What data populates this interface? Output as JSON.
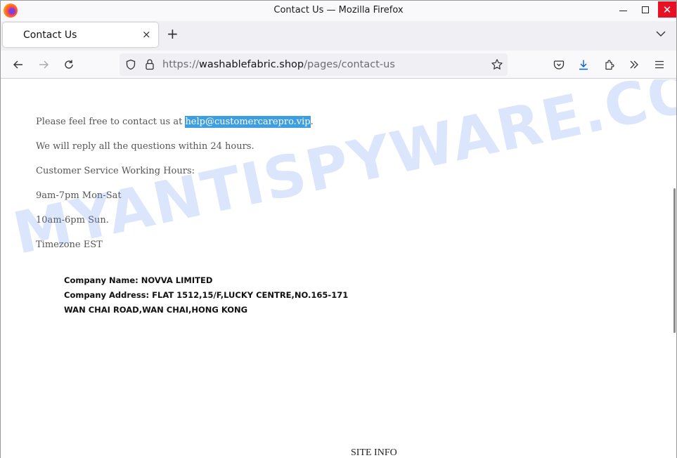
{
  "window": {
    "title": "Contact Us — Mozilla Firefox",
    "minimize_label": "—",
    "close_label": "✕"
  },
  "tabs": [
    {
      "label": "Contact Us",
      "active": true,
      "close_label": "×"
    }
  ],
  "tabstrip": {
    "new_tab_label": "+"
  },
  "navbar": {
    "url_scheme": "https://",
    "url_host": "washablefabric.shop",
    "url_path": "/pages/contact-us",
    "icons": [
      "back-icon",
      "forward-icon",
      "reload-icon",
      "shield-icon",
      "lock-icon",
      "bookmark-star-icon",
      "pocket-icon",
      "download-icon",
      "extensions-icon",
      "overflow-icon",
      "menu-icon"
    ]
  },
  "page": {
    "contact_prefix": "Please feel free to contact us at ",
    "contact_email": "help@customercarepro.vip",
    "contact_suffix": ".",
    "lines": [
      "We will reply all the questions within 24 hours.",
      "Customer Service Working Hours:",
      "9am-7pm Mon-Sat",
      "10am-6pm Sun.",
      "Timezone EST"
    ],
    "company_name": "Company Name: NOVVA LIMITED",
    "company_address_1": "Company Address: FLAT 1512,15/F,LUCKY CENTRE,NO.165-171",
    "company_address_2": "WAN CHAI ROAD,WAN CHAI,HONG KONG",
    "footer_heading": "SITE INFO"
  },
  "watermark": "MYANTISPYWARE.COM",
  "colors": {
    "selection_highlight": "#3d9ee2",
    "close_button": "#e81123",
    "download_accent": "#0061e0"
  }
}
